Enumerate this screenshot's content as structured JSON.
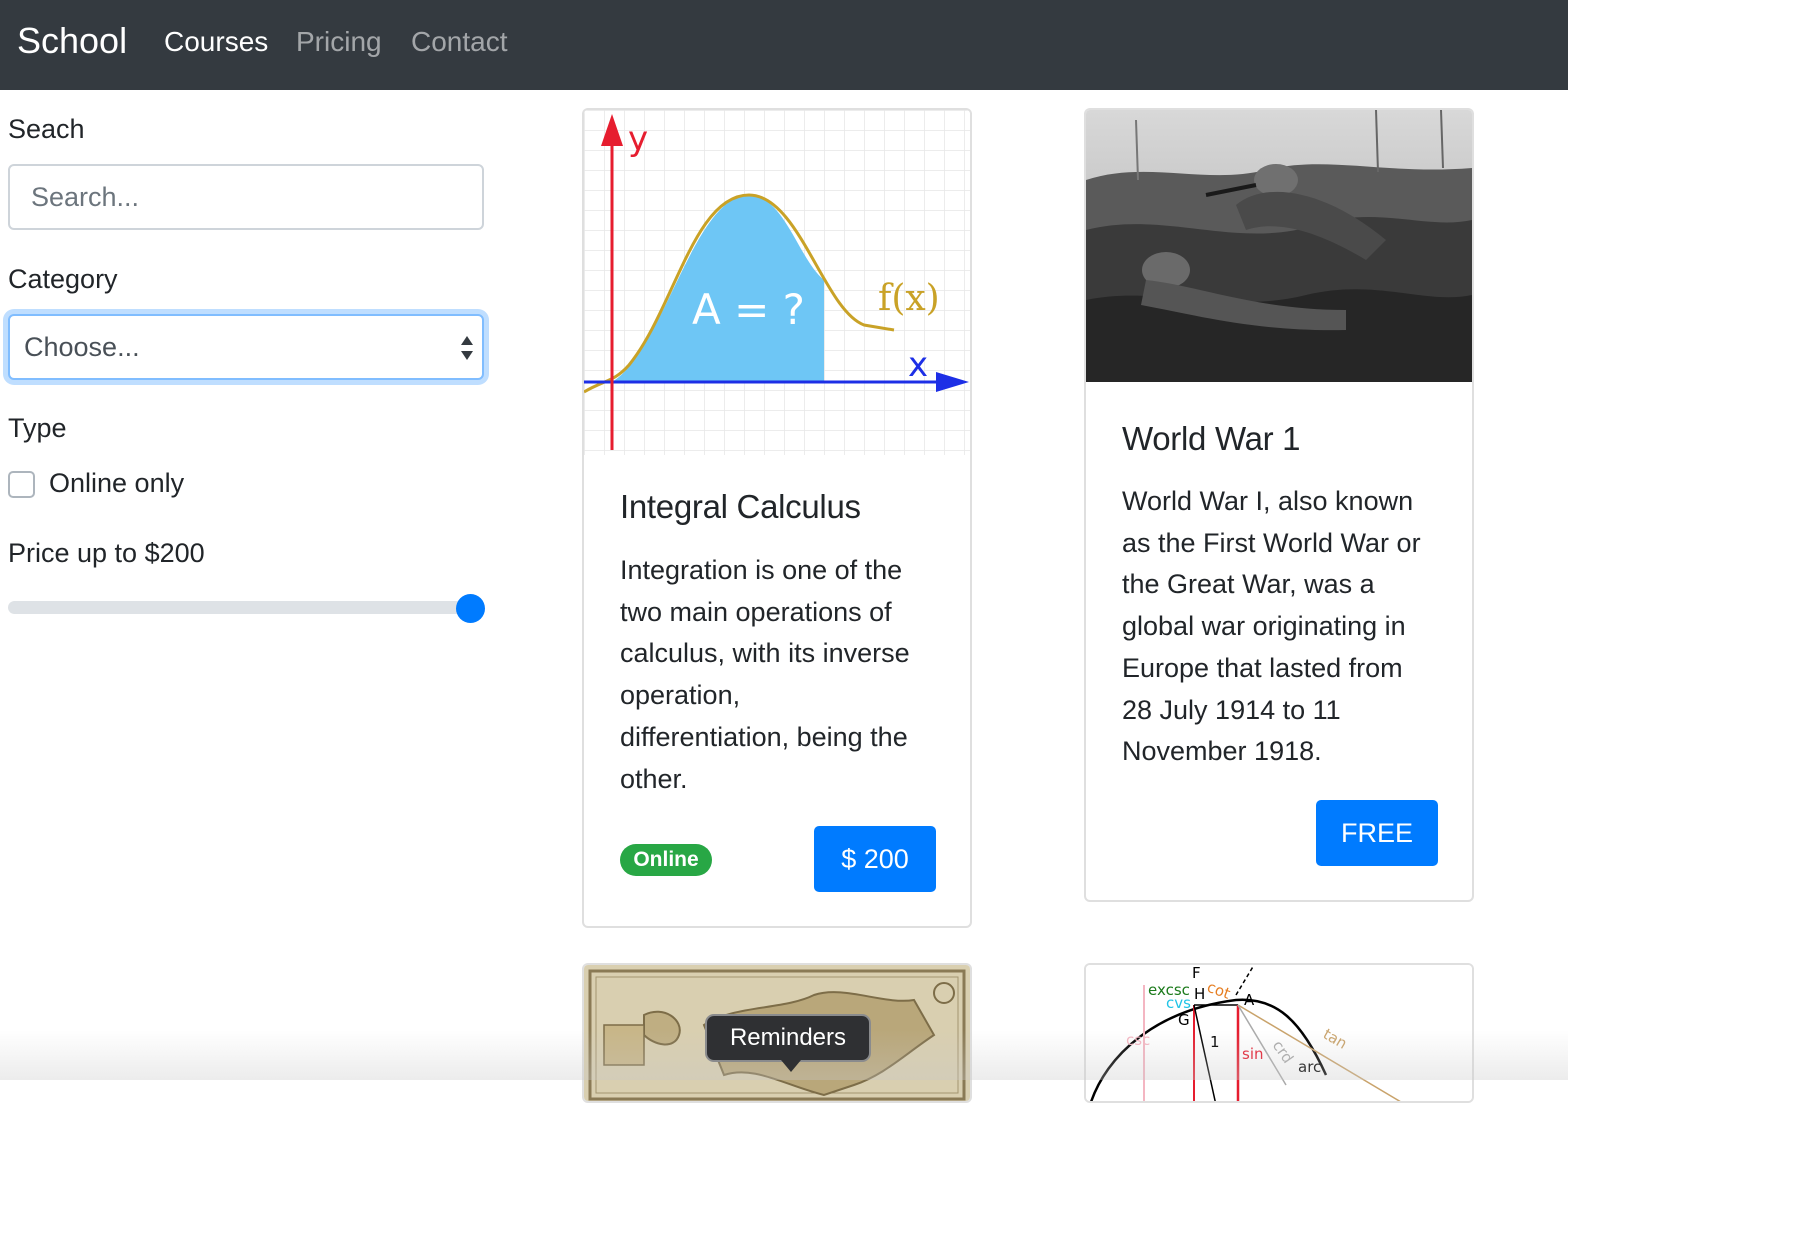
{
  "navbar": {
    "brand": "School",
    "links": [
      {
        "label": "Courses",
        "active": true
      },
      {
        "label": "Pricing",
        "active": false
      },
      {
        "label": "Contact",
        "active": false
      }
    ]
  },
  "filters": {
    "search_label": "Seach",
    "search_placeholder": "Search...",
    "category_label": "Category",
    "category_selected": "Choose...",
    "type_label": "Type",
    "online_only_label": "Online only",
    "online_only_checked": false,
    "price_label": "Price up to $200",
    "price_fraction": 1.0
  },
  "courses": [
    {
      "title": "Integral Calculus",
      "description_lines": [
        "Integration is one of the",
        "two main operations of",
        "calculus, with its inverse",
        "operation,",
        "differentiation, being the",
        "other."
      ],
      "badge": "Online",
      "price_button": "$ 200",
      "image_labels": {
        "y_axis": "y",
        "x_axis": "x",
        "function": "f(x)",
        "area": "A = ?"
      }
    },
    {
      "title": "World War 1",
      "description_lines": [
        "World War I, also known",
        "as the First World War or",
        "the Great War, was a",
        "global war originating in",
        "Europe that lasted from",
        "28 July 1914 to 11",
        "November 1918."
      ],
      "price_button": "FREE"
    }
  ],
  "trig_image_labels": {
    "f": "F",
    "excsc": "excsc",
    "h": "H",
    "cot": "cot",
    "a": "A",
    "cvs": "cvs",
    "g": "G",
    "csc": "csc",
    "one": "1",
    "sin": "sin",
    "crd": "crd",
    "arc": "arc",
    "tan": "tan"
  },
  "tooltip": {
    "text": "Reminders"
  },
  "colors": {
    "navbar": "#343a40",
    "primary": "#007bff",
    "success": "#28a745"
  }
}
